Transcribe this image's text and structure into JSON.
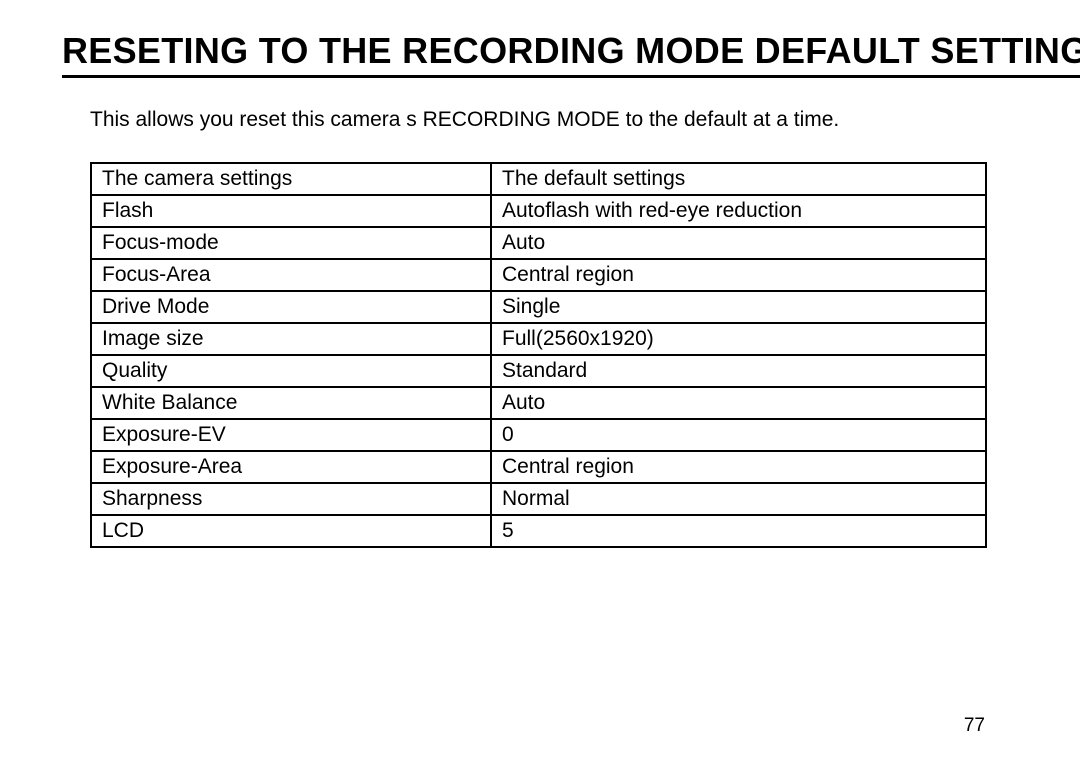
{
  "heading": "RESETING TO THE RECORDING MODE DEFAULT SETTING",
  "intro": "This allows you reset this camera s RECORDING MODE to the default at a time.",
  "table": {
    "header": {
      "left": "The camera settings",
      "right": "The default settings"
    },
    "rows": [
      {
        "left": "Flash",
        "right": "Autoflash with red-eye reduction"
      },
      {
        "left": "Focus-mode",
        "right": "Auto"
      },
      {
        "left": "Focus-Area",
        "right": "Central region"
      },
      {
        "left": "Drive Mode",
        "right": "Single"
      },
      {
        "left": "Image size",
        "right": "Full(2560x1920)"
      },
      {
        "left": "Quality",
        "right": "Standard"
      },
      {
        "left": "White Balance",
        "right": "Auto"
      },
      {
        "left": "Exposure-EV",
        "right": "0"
      },
      {
        "left": "Exposure-Area",
        "right": "Central region"
      },
      {
        "left": "Sharpness",
        "right": "Normal"
      },
      {
        "left": "LCD",
        "right": "5"
      }
    ]
  },
  "page_number": "77"
}
